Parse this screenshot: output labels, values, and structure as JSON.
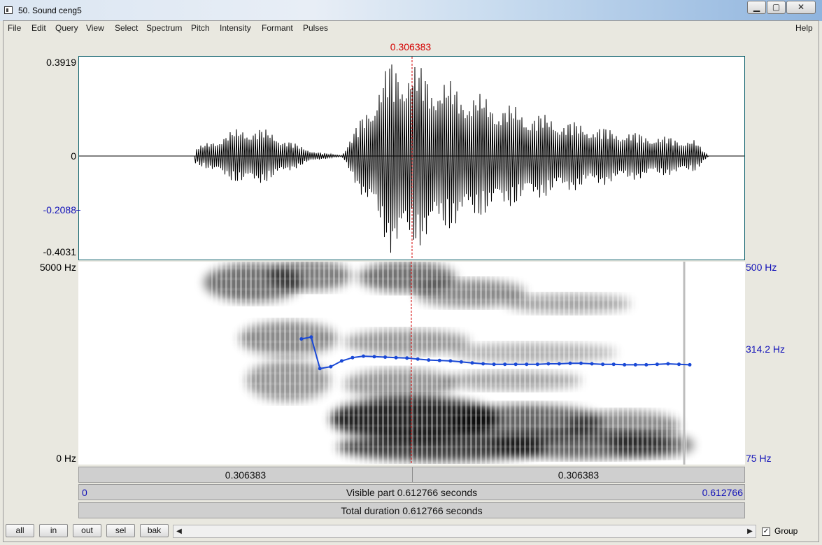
{
  "window": {
    "title": "50. Sound ceng5"
  },
  "menu": {
    "items": [
      "File",
      "Edit",
      "Query",
      "View",
      "Select",
      "Spectrum",
      "Pitch",
      "Intensity",
      "Formant",
      "Pulses"
    ],
    "help": "Help"
  },
  "cursor": {
    "time_label": "0.306383"
  },
  "waveform": {
    "y_max": "0.3919",
    "y_zero": "0",
    "y_mark": "-0.2088",
    "y_min": "-0.4031"
  },
  "spectrogram": {
    "freq_max": "5000 Hz",
    "freq_min": "0 Hz"
  },
  "pitch": {
    "max_label": "500 Hz",
    "mark_label": "314.2 Hz",
    "min_label": "75 Hz",
    "color": "#1a49d6"
  },
  "time_bars": {
    "left_segment": "0.306383",
    "right_segment": "0.306383",
    "visible_start": "0",
    "visible_label": "Visible part 0.612766 seconds",
    "visible_end": "0.612766",
    "total_label": "Total duration 0.612766 seconds"
  },
  "bottom": {
    "buttons": [
      "all",
      "in",
      "out",
      "sel",
      "bak"
    ],
    "group_label": "Group",
    "group_checked": true
  },
  "colors": {
    "cursor": "#d40000",
    "axis_blue": "#1010b8"
  },
  "chart_data": {
    "type": "line",
    "xlabel": "",
    "ylabel": "",
    "x_range_seconds": [
      0,
      0.612766
    ],
    "ylim_hz": [
      75,
      500
    ],
    "series": [
      {
        "x": [
          0.205,
          0.214,
          0.222,
          0.232,
          0.242,
          0.252,
          0.262,
          0.272,
          0.282,
          0.292,
          0.302,
          0.312,
          0.322,
          0.332,
          0.342,
          0.352,
          0.362,
          0.372,
          0.382,
          0.392,
          0.402,
          0.412,
          0.422,
          0.432,
          0.442,
          0.452,
          0.462,
          0.472,
          0.482,
          0.492,
          0.502,
          0.512,
          0.522,
          0.532,
          0.542,
          0.552,
          0.562
        ],
        "values": [
          338,
          342,
          276,
          280,
          292,
          299,
          302,
          301,
          300,
          299,
          298,
          296,
          294,
          293,
          292,
          290,
          288,
          286,
          285,
          285,
          285,
          285,
          285,
          286,
          286,
          287,
          287,
          286,
          285,
          285,
          284,
          284,
          284,
          285,
          286,
          285,
          284
        ]
      }
    ]
  }
}
